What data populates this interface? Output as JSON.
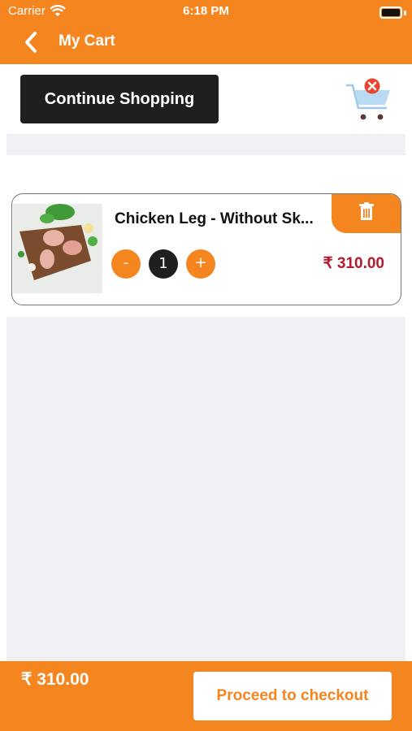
{
  "status_bar": {
    "carrier": "Carrier",
    "time": "6:18 PM"
  },
  "header": {
    "title": "My Cart",
    "back_icon": "chevron-left-icon"
  },
  "toolbar": {
    "continue_label": "Continue Shopping",
    "clear_cart_icon": "cart-clear-icon"
  },
  "cart": {
    "items": [
      {
        "name": "Chicken Leg - Without Sk...",
        "quantity": "1",
        "minus_label": "-",
        "plus_label": "+",
        "price": "₹ 310.00",
        "delete_icon": "trash-icon"
      }
    ]
  },
  "footer": {
    "total": "₹ 310.00",
    "checkout_label": "Proceed to checkout"
  },
  "colors": {
    "brand": "#f5851f",
    "dark": "#1f1f1f",
    "price": "#b51a2c",
    "background_gray": "#efeff4"
  }
}
